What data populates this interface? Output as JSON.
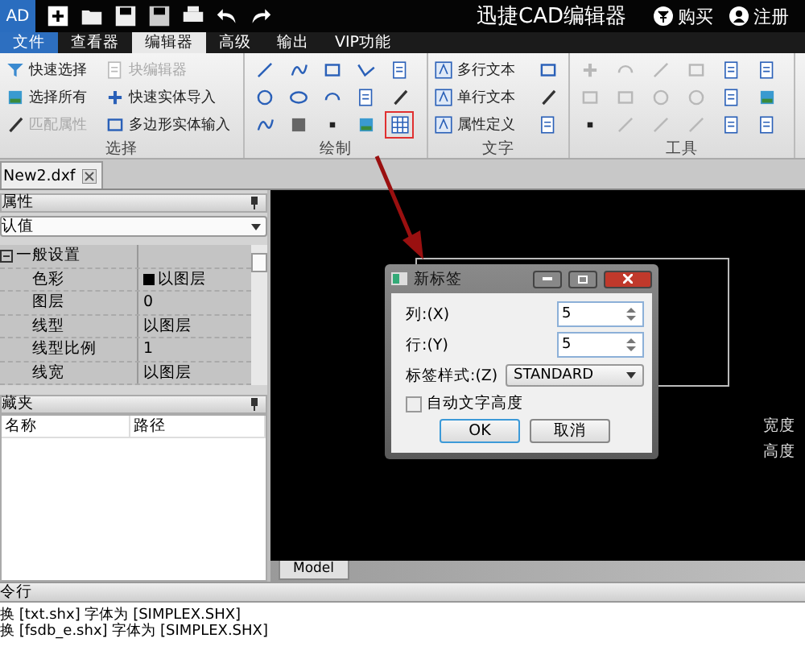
{
  "app": {
    "logo": "AD",
    "title": "迅捷CAD编辑器",
    "actions": [
      {
        "label": "购买",
        "kind": "buy"
      },
      {
        "label": "注册",
        "kind": "user"
      }
    ]
  },
  "tabs": [
    {
      "label": "文件",
      "kind": "menu",
      "selected": false
    },
    {
      "label": "查看器",
      "kind": "tab",
      "selected": false
    },
    {
      "label": "编辑器",
      "kind": "tab",
      "selected": true
    },
    {
      "label": "高级",
      "kind": "tab",
      "selected": false
    },
    {
      "label": "输出",
      "kind": "tab",
      "selected": false
    },
    {
      "label": "VIP功能",
      "kind": "tab",
      "selected": false
    }
  ],
  "ribbon": {
    "select_group": {
      "label": "选择",
      "items": [
        {
          "label": "快速选择",
          "disabled": false
        },
        {
          "label": "块编辑器",
          "disabled": true
        },
        {
          "label": "选择所有",
          "disabled": false
        },
        {
          "label": "快速实体导入",
          "disabled": false
        },
        {
          "label": "匹配属性",
          "disabled": true
        },
        {
          "label": "多边形实体输入",
          "disabled": false
        }
      ]
    },
    "draw_group": {
      "label": "绘制",
      "table_highlighted": true
    },
    "text_group": {
      "label": "文字",
      "items": [
        {
          "label": "多行文本"
        },
        {
          "label": "单行文本"
        },
        {
          "label": "属性定义"
        }
      ]
    },
    "tools_group": {
      "label": "工具"
    }
  },
  "document_tab": {
    "label": "New2.dxf"
  },
  "properties": {
    "title": "属性",
    "preset": "认值",
    "rows": [
      {
        "kind": "category",
        "name": "一般设置",
        "expanded": true
      },
      {
        "kind": "color",
        "name": "色彩",
        "value": "以图层"
      },
      {
        "kind": "text",
        "name": "图层",
        "value": "0"
      },
      {
        "kind": "text",
        "name": "线型",
        "value": "以图层"
      },
      {
        "kind": "text",
        "name": "线型比例",
        "value": "1"
      },
      {
        "kind": "text",
        "name": "线宽",
        "value": "以图层"
      }
    ]
  },
  "favorites": {
    "title": "藏夹",
    "columns": [
      "名称",
      "路径"
    ]
  },
  "canvas": {
    "labels": [
      "宽度",
      "高度"
    ],
    "layout_tab": "Model"
  },
  "dialog": {
    "title": "新标签",
    "columns_label": "列:(X)",
    "columns_value": "5",
    "rows_label": "行:(Y)",
    "rows_value": "5",
    "style_label": "标签样式:(Z)",
    "style_value": "STANDARD",
    "auto_height": {
      "label": "自动文字高度",
      "checked": false
    },
    "ok": "OK",
    "cancel": "取消"
  },
  "command_line": {
    "title": "令行",
    "lines": [
      "换 [txt.shx] 字体为 [SIMPLEX.SHX]",
      "换 [fsdb_e.shx] 字体为 [SIMPLEX.SHX]"
    ]
  }
}
